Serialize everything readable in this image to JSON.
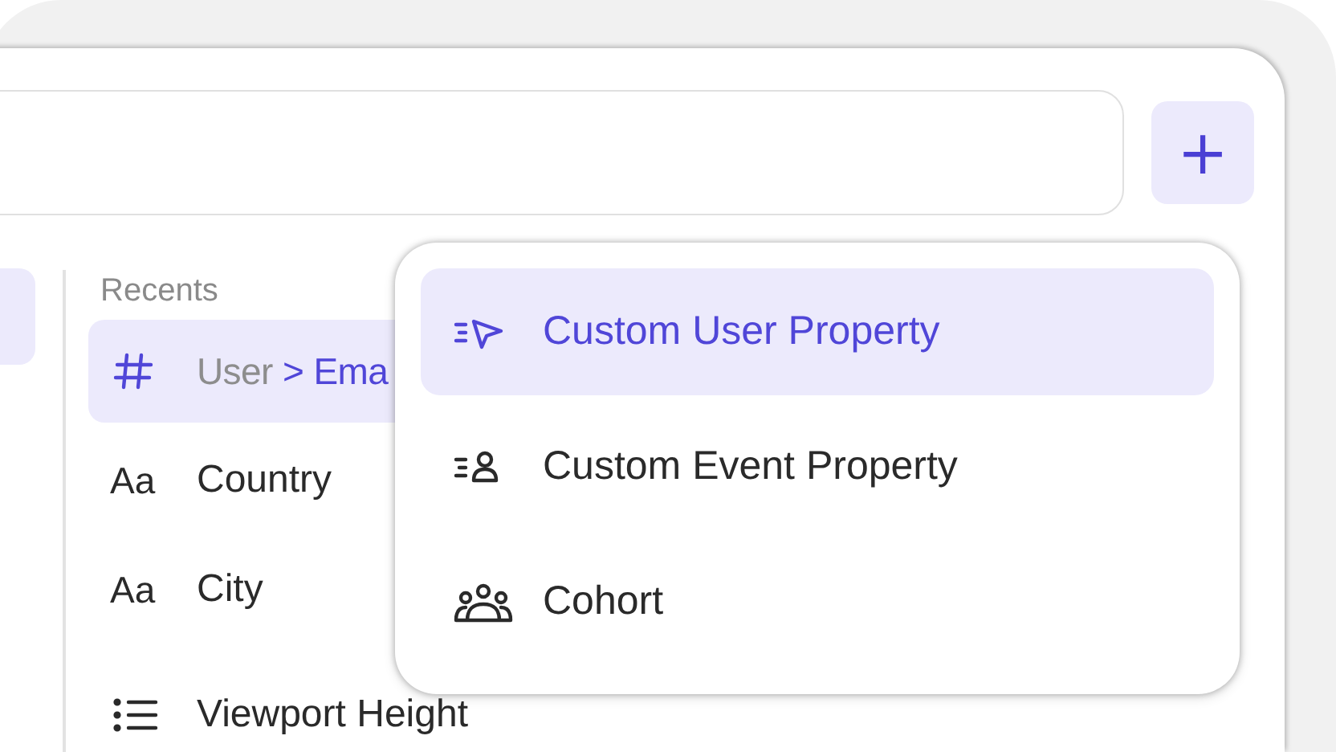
{
  "add_button": {
    "label": "+"
  },
  "sidebar": {
    "items": [
      {
        "selected": true
      }
    ]
  },
  "recents": {
    "title": "Recents",
    "items": [
      {
        "kind": "number",
        "parent": "User",
        "separator": ">",
        "label": "Ema",
        "selected": true
      },
      {
        "kind": "text",
        "glyph": "Aa",
        "label": "Country",
        "selected": false
      },
      {
        "kind": "text",
        "glyph": "Aa",
        "label": "City",
        "selected": false
      },
      {
        "kind": "list",
        "label": "Viewport Height",
        "selected": false
      }
    ]
  },
  "menu": {
    "items": [
      {
        "kind": "user_property",
        "label": "Custom User Property",
        "selected": true
      },
      {
        "kind": "event_property",
        "label": "Custom Event Property",
        "selected": false
      },
      {
        "kind": "cohort",
        "label": "Cohort",
        "selected": false
      }
    ]
  }
}
